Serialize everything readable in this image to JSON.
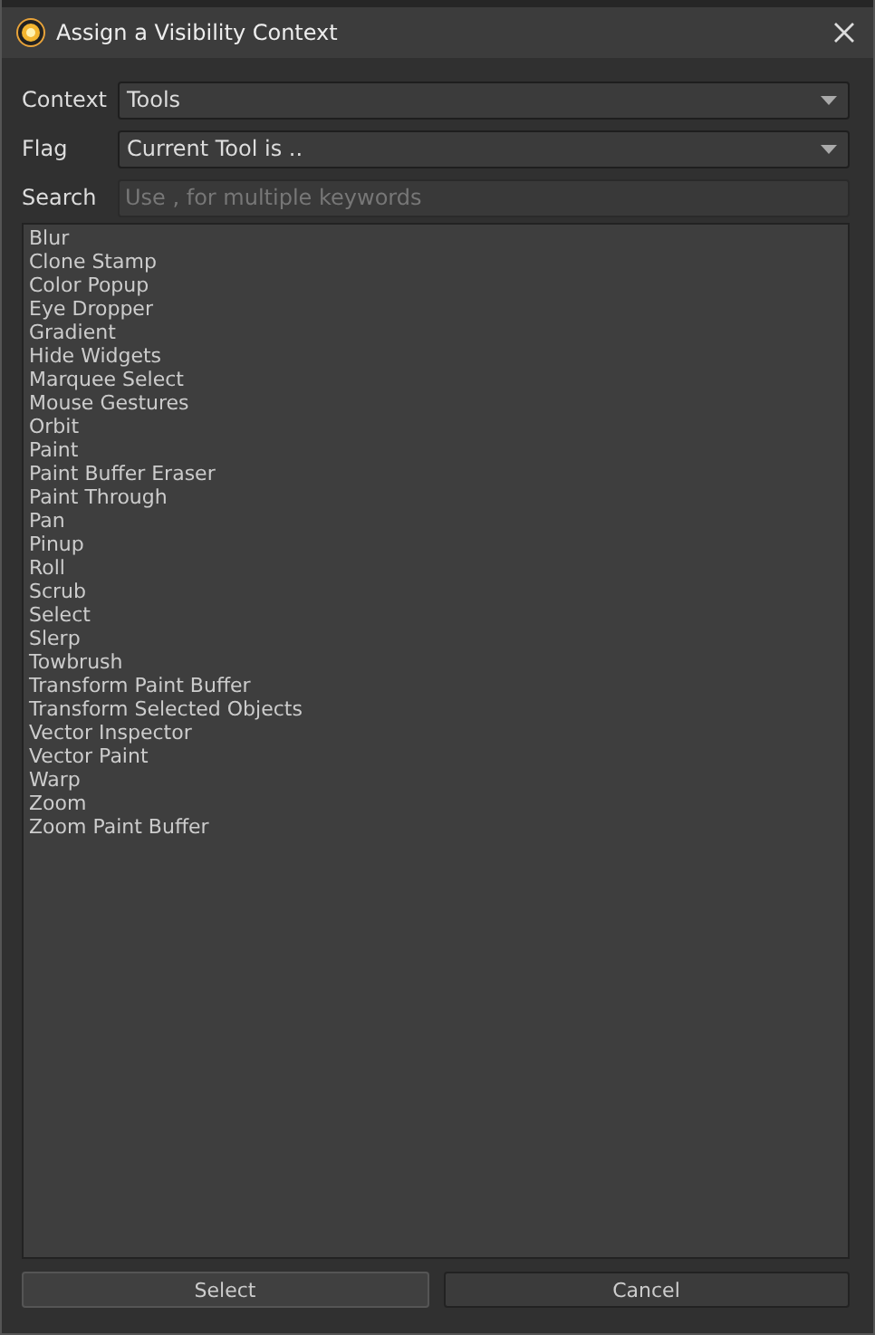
{
  "window": {
    "title": "Assign a Visibility Context"
  },
  "fields": [
    {
      "kind": "dropdown",
      "label": "Context",
      "value": "Tools"
    },
    {
      "kind": "dropdown",
      "label": "Flag",
      "value": "Current Tool is .."
    },
    {
      "kind": "search",
      "label": "Search",
      "placeholder": "Use , for multiple keywords"
    }
  ],
  "list": {
    "items": [
      "Blur",
      "Clone Stamp",
      "Color Popup",
      "Eye Dropper",
      "Gradient",
      "Hide Widgets",
      "Marquee Select",
      "Mouse Gestures",
      "Orbit",
      "Paint",
      "Paint Buffer Eraser",
      "Paint Through",
      "Pan",
      "Pinup",
      "Roll",
      "Scrub",
      "Select",
      "Slerp",
      "Towbrush",
      "Transform Paint Buffer",
      "Transform Selected Objects",
      "Vector Inspector",
      "Vector Paint",
      "Warp",
      "Zoom",
      "Zoom Paint Buffer"
    ]
  },
  "buttons": [
    "Select",
    "Cancel"
  ]
}
